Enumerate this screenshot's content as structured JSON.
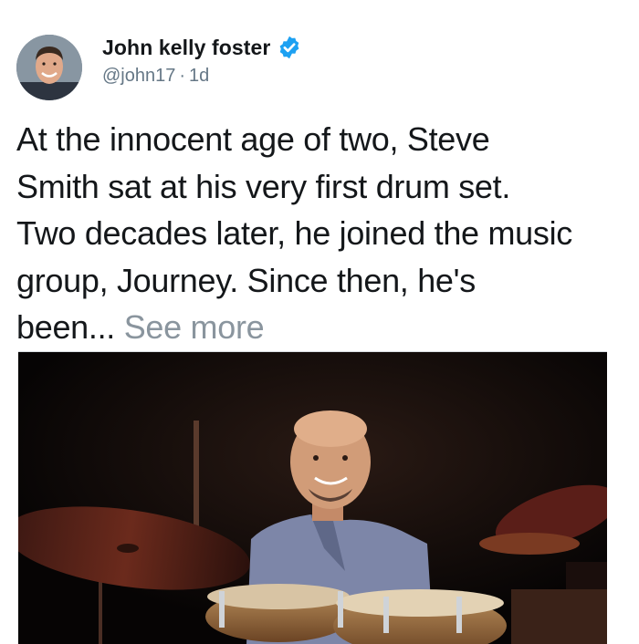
{
  "author": {
    "display_name": "John kelly foster",
    "handle": "@john17",
    "separator": "·",
    "time": "1d",
    "verified": true,
    "verified_color": "#1da1f2"
  },
  "tweet": {
    "body_lines": [
      "At the innocent age of two, Steve",
      "Smith sat at his very first drum set.",
      "Two decades later, he joined the music",
      "group, Journey. Since then, he's",
      "been..."
    ],
    "see_more": "See more"
  },
  "icons": {
    "verified": "verified-badge-icon",
    "avatar": "avatar"
  },
  "colors": {
    "text": "#14171a",
    "muted": "#657786",
    "see_more": "#8a959e"
  }
}
